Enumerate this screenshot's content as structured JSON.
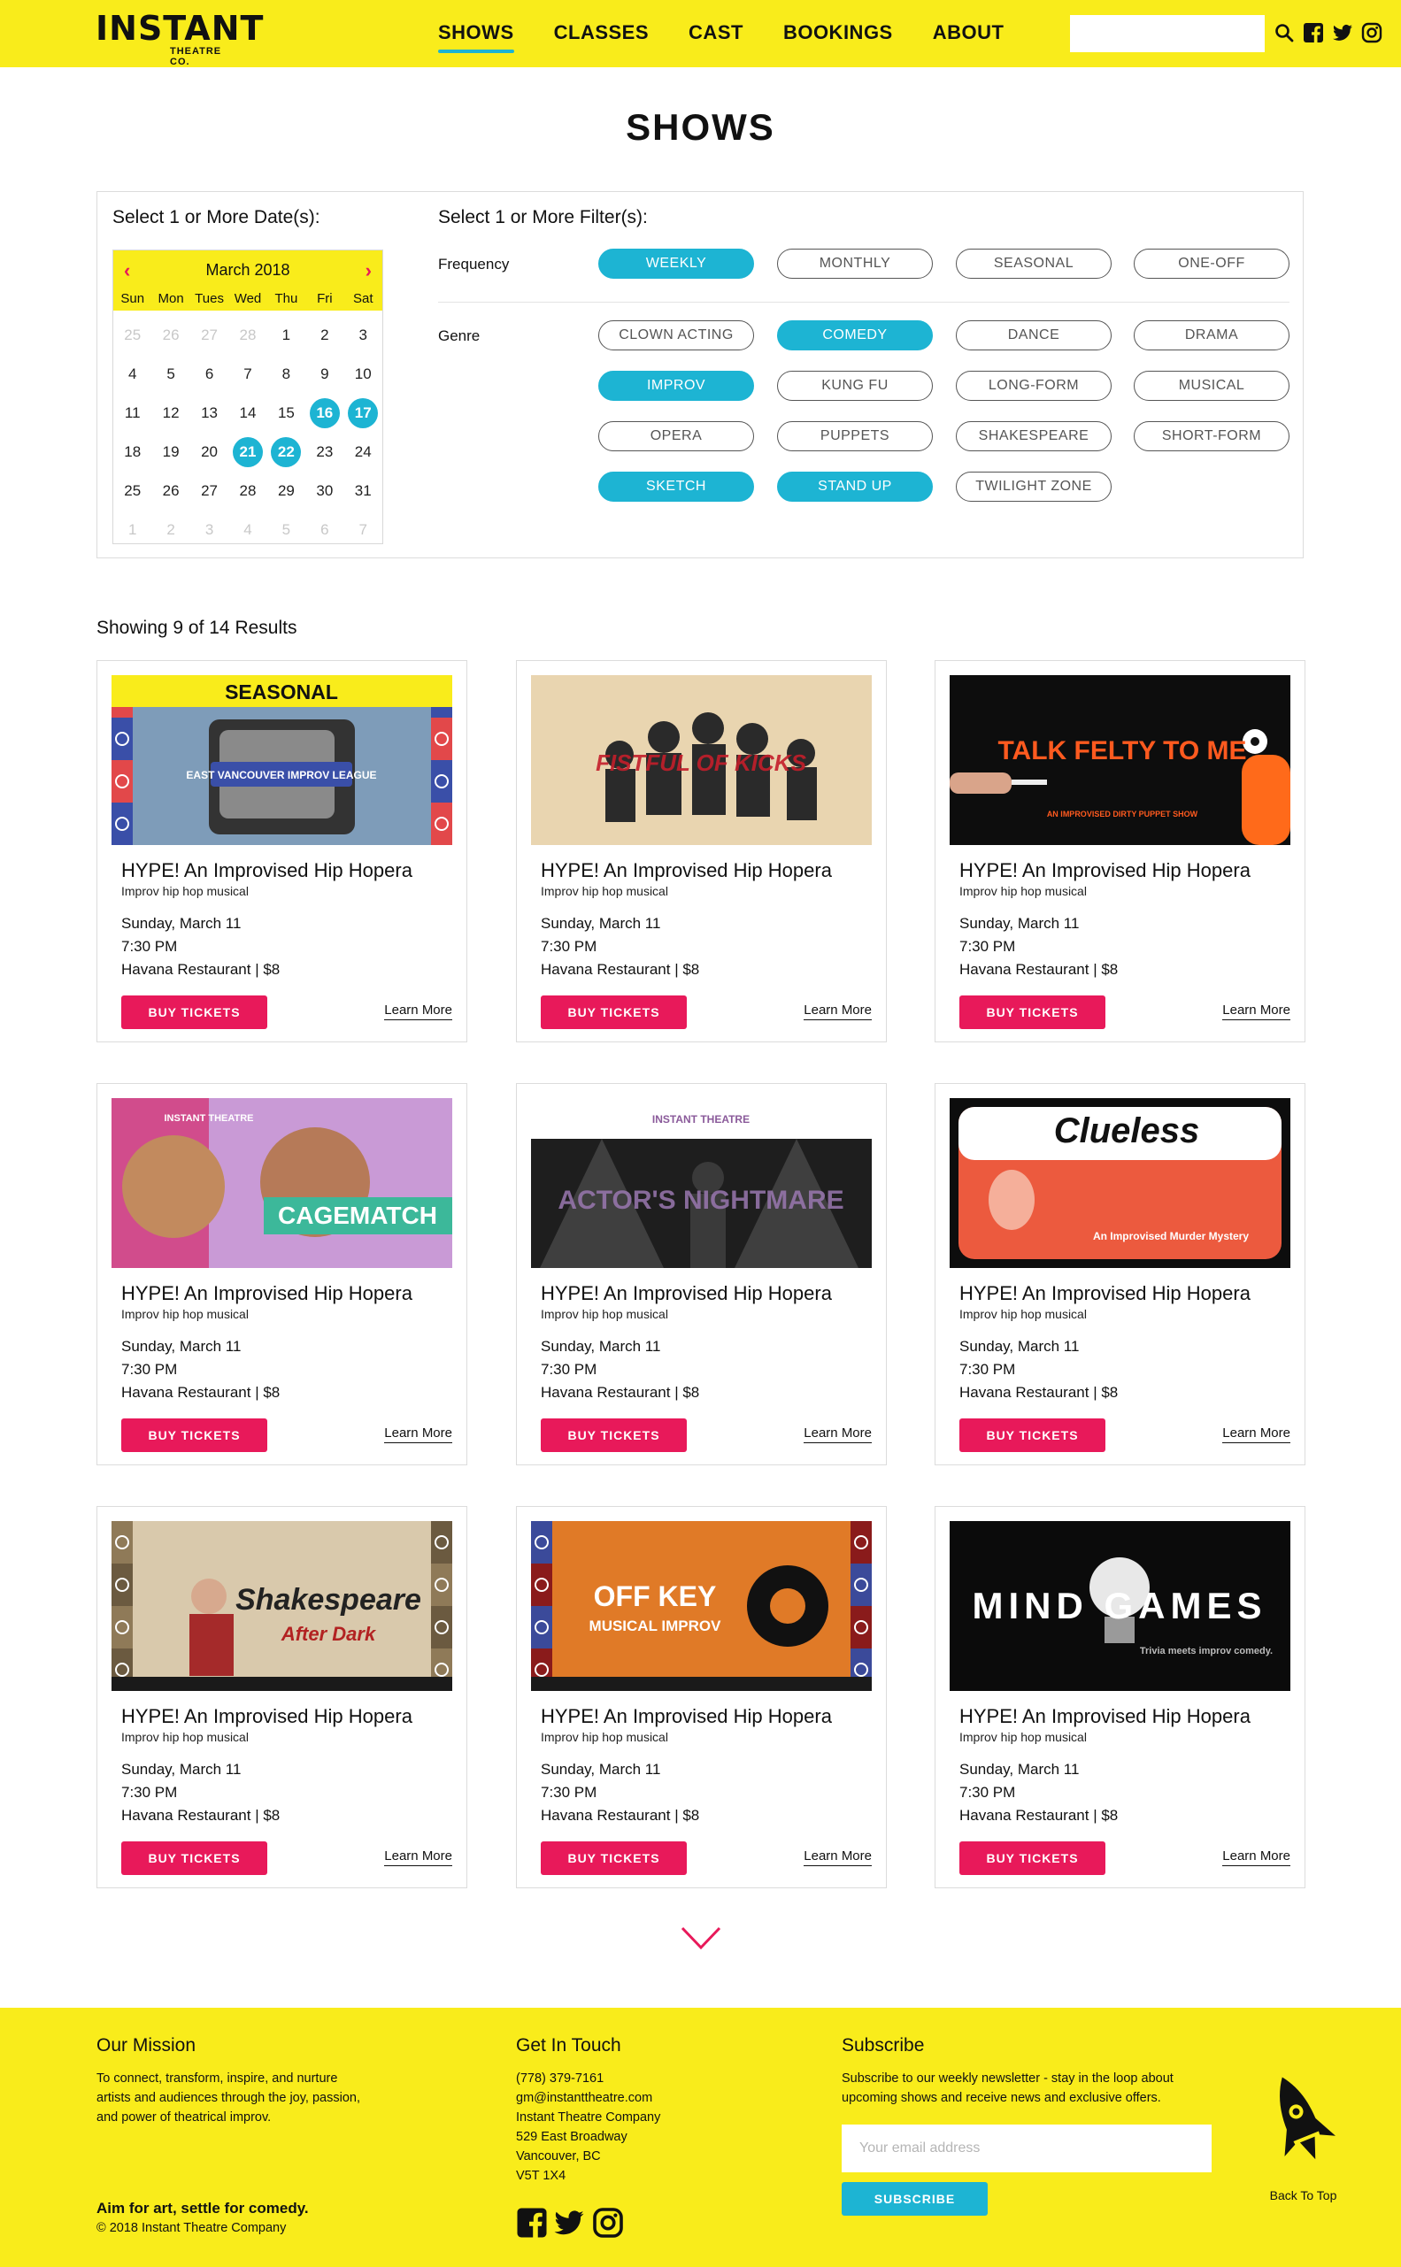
{
  "header": {
    "logo_main": "INSTANT",
    "logo_sub": "THEATRE CO.",
    "nav": [
      "SHOWS",
      "CLASSES",
      "CAST",
      "BOOKINGS",
      "ABOUT"
    ],
    "active_nav": "SHOWS",
    "search_placeholder": "",
    "icons": [
      "search-icon",
      "facebook-icon",
      "twitter-icon",
      "instagram-icon"
    ]
  },
  "page_title": "SHOWS",
  "filters": {
    "date_label": "Select 1 or More Date(s):",
    "filter_label": "Select 1 or More Filter(s):",
    "calendar": {
      "month": "March 2018",
      "prev": "‹",
      "next": "›",
      "weekdays": [
        "Sun",
        "Mon",
        "Tues",
        "Wed",
        "Thu",
        "Fri",
        "Sat"
      ],
      "weeks": [
        [
          "25",
          "26",
          "27",
          "28",
          "1",
          "2",
          "3"
        ],
        [
          "4",
          "5",
          "6",
          "7",
          "8",
          "9",
          "10"
        ],
        [
          "11",
          "12",
          "13",
          "14",
          "15",
          "16",
          "17"
        ],
        [
          "18",
          "19",
          "20",
          "21",
          "22",
          "23",
          "24"
        ],
        [
          "25",
          "26",
          "27",
          "28",
          "29",
          "30",
          "31"
        ],
        [
          "1",
          "2",
          "3",
          "4",
          "5",
          "6",
          "7"
        ]
      ],
      "selected_days": [
        "16",
        "17",
        "21",
        "22"
      ]
    },
    "frequency_label": "Frequency",
    "frequency": [
      {
        "label": "WEEKLY",
        "on": true
      },
      {
        "label": "MONTHLY",
        "on": false
      },
      {
        "label": "SEASONAL",
        "on": false
      },
      {
        "label": "ONE-OFF",
        "on": false
      }
    ],
    "genre_label": "Genre",
    "genre": [
      {
        "label": "CLOWN ACTING",
        "on": false
      },
      {
        "label": "COMEDY",
        "on": true
      },
      {
        "label": "DANCE",
        "on": false
      },
      {
        "label": "DRAMA",
        "on": false
      },
      {
        "label": "IMPROV",
        "on": true
      },
      {
        "label": "KUNG FU",
        "on": false
      },
      {
        "label": "LONG-FORM",
        "on": false
      },
      {
        "label": "MUSICAL",
        "on": false
      },
      {
        "label": "OPERA",
        "on": false
      },
      {
        "label": "PUPPETS",
        "on": false
      },
      {
        "label": "SHAKESPEARE",
        "on": false
      },
      {
        "label": "SHORT-FORM",
        "on": false
      },
      {
        "label": "SKETCH",
        "on": true
      },
      {
        "label": "STAND UP",
        "on": true
      },
      {
        "label": "TWILIGHT ZONE",
        "on": false
      }
    ]
  },
  "results_count": "Showing 9 of 14 Results",
  "cards": [
    {
      "poster": "SEASONAL",
      "poster_text": "EAST VANCOUVER IMPROV LEAGUE",
      "title": "HYPE! An Improvised Hip Hopera",
      "subtitle": "Improv hip hop musical",
      "date": "Sunday, March 11",
      "time": "7:30 PM",
      "venue": "Havana Restaurant | $8",
      "buy": "BUY TICKETS",
      "learn": "Learn More"
    },
    {
      "poster": "FISTFUL OF KICKS",
      "poster_text": "",
      "title": "HYPE! An Improvised Hip Hopera",
      "subtitle": "Improv hip hop musical",
      "date": "Sunday, March 11",
      "time": "7:30 PM",
      "venue": "Havana Restaurant | $8",
      "buy": "BUY TICKETS",
      "learn": "Learn More"
    },
    {
      "poster": "TALK FELTY TO ME",
      "poster_text": "AN IMPROVISED DIRTY PUPPET SHOW",
      "title": "HYPE! An Improvised Hip Hopera",
      "subtitle": "Improv hip hop musical",
      "date": "Sunday, March 11",
      "time": "7:30 PM",
      "venue": "Havana Restaurant | $8",
      "buy": "BUY TICKETS",
      "learn": "Learn More"
    },
    {
      "poster": "CAGEMATCH",
      "poster_text": "INSTANT THEATRE",
      "title": "HYPE! An Improvised Hip Hopera",
      "subtitle": "Improv hip hop musical",
      "date": "Sunday, March 11",
      "time": "7:30 PM",
      "venue": "Havana Restaurant | $8",
      "buy": "BUY TICKETS",
      "learn": "Learn More"
    },
    {
      "poster": "ACTOR'S NIGHTMARE",
      "poster_text": "INSTANT THEATRE",
      "title": "HYPE! An Improvised Hip Hopera",
      "subtitle": "Improv hip hop musical",
      "date": "Sunday, March 11",
      "time": "7:30 PM",
      "venue": "Havana Restaurant | $8",
      "buy": "BUY TICKETS",
      "learn": "Learn More"
    },
    {
      "poster": "Clueless",
      "poster_text": "An Improvised Murder Mystery",
      "title": "HYPE! An Improvised Hip Hopera",
      "subtitle": "Improv hip hop musical",
      "date": "Sunday, March 11",
      "time": "7:30 PM",
      "venue": "Havana Restaurant | $8",
      "buy": "BUY TICKETS",
      "learn": "Learn More"
    },
    {
      "poster": "Shakespeare",
      "poster_text": "After Dark",
      "title": "HYPE! An Improvised Hip Hopera",
      "subtitle": "Improv hip hop musical",
      "date": "Sunday, March 11",
      "time": "7:30 PM",
      "venue": "Havana Restaurant | $8",
      "buy": "BUY TICKETS",
      "learn": "Learn More"
    },
    {
      "poster": "OFF KEY",
      "poster_text": "MUSICAL IMPROV",
      "title": "HYPE! An Improvised Hip Hopera",
      "subtitle": "Improv hip hop musical",
      "date": "Sunday, March 11",
      "time": "7:30 PM",
      "venue": "Havana Restaurant | $8",
      "buy": "BUY TICKETS",
      "learn": "Learn More"
    },
    {
      "poster": "MIND GAMES",
      "poster_text": "Trivia meets improv comedy.",
      "title": "HYPE! An Improvised Hip Hopera",
      "subtitle": "Improv hip hop musical",
      "date": "Sunday, March 11",
      "time": "7:30 PM",
      "venue": "Havana Restaurant | $8",
      "buy": "BUY TICKETS",
      "learn": "Learn More"
    }
  ],
  "footer": {
    "mission_title": "Our Mission",
    "mission_text": [
      "To connect, transform, inspire, and nurture",
      "artists and audiences through the joy, passion,",
      "and power of theatrical improv."
    ],
    "tagline": "Aim for art, settle for comedy.",
    "copyright": "© 2018 Instant Theatre Company",
    "contact_title": "Get In Touch",
    "contact_lines": [
      "(778) 379-7161",
      "gm@instanttheatre.com",
      "Instant Theatre Company",
      "529 East Broadway",
      "Vancouver, BC",
      "V5T 1X4"
    ],
    "subscribe_title": "Subscribe",
    "subscribe_text": [
      "Subscribe to our weekly newsletter - stay in the loop about",
      "upcoming shows and receive news and exclusive offers."
    ],
    "email_placeholder": "Your email address",
    "subscribe_button": "SUBSCRIBE",
    "back_to_top": "Back To Top"
  },
  "colors": {
    "brand_yellow": "#f9ec1b",
    "accent_cyan": "#1db4d3",
    "accent_pink": "#e8195a"
  }
}
